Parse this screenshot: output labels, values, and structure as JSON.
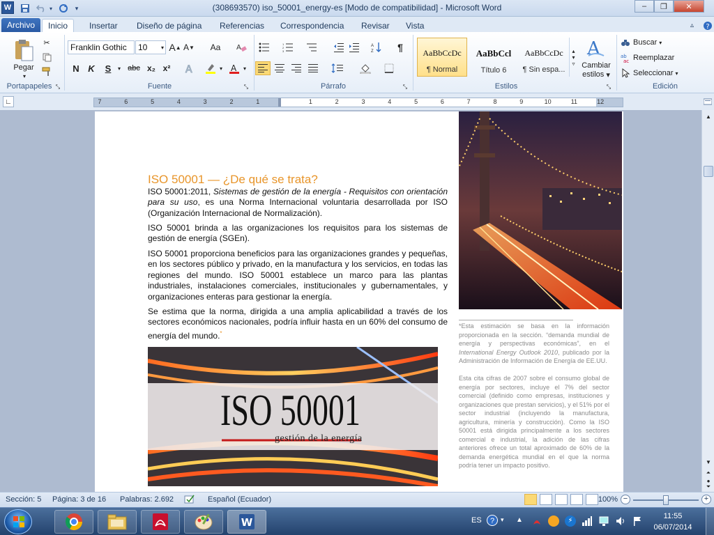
{
  "window": {
    "title": "(308693570) iso_50001_energy-es [Modo de compatibilidad]  -  Microsoft Word",
    "minimize": "–",
    "maximize": "❐",
    "close": "✕"
  },
  "qat": {
    "word_icon": "W",
    "save_icon": "save-icon",
    "undo_icon": "undo-icon",
    "redo_icon": "redo-icon"
  },
  "tabs": [
    "Archivo",
    "Inicio",
    "Insertar",
    "Diseño de página",
    "Referencias",
    "Correspondencia",
    "Revisar",
    "Vista"
  ],
  "ribbon": {
    "clipboard": {
      "paste_label": "Pegar",
      "group_label": "Portapapeles"
    },
    "font": {
      "font_name": "Franklin Gothic",
      "font_size": "10",
      "group_label": "Fuente",
      "bold": "N",
      "italic": "K",
      "underline": "S",
      "strike": "abc",
      "sub": "x₂",
      "sup": "x²",
      "grow": "A",
      "shrink": "A",
      "case": "Aa"
    },
    "paragraph": {
      "group_label": "Párrafo",
      "pilcrow": "¶"
    },
    "styles": {
      "group_label": "Estilos",
      "items": [
        {
          "preview": "AaBbCcDc",
          "label": "¶ Normal"
        },
        {
          "preview": "AaBbCcl",
          "label": "Título 6"
        },
        {
          "preview": "AaBbCcDc",
          "label": "¶ Sin espa..."
        }
      ],
      "change_label_1": "Cambiar",
      "change_label_2": "estilos"
    },
    "editing": {
      "group_label": "Edición",
      "find": "Buscar",
      "replace": "Reemplazar",
      "select": "Seleccionar"
    }
  },
  "ruler": {
    "ticks": [
      "7",
      "6",
      "5",
      "4",
      "3",
      "2",
      "1",
      "",
      "1",
      "2",
      "3",
      "4",
      "5",
      "6",
      "7",
      "8",
      "9",
      "10",
      "11",
      "12"
    ]
  },
  "document": {
    "heading": "ISO 50001 — ¿De qué se trata?",
    "p1_a": "ISO 50001:2011, ",
    "p1_b": "Sistemas de gestión de la energía - Requisitos con orientación para su uso",
    "p1_c": ", es una Norma Internacional voluntaria desarrollada por ISO (Organización Internacional de Normalización).",
    "p2": "ISO 50001 brinda a las organizaciones  los requisitos para los sistemas de gestión de energía (SGEn).",
    "p3": "ISO 50001 proporciona beneficios para las organizaciones grandes y pequeñas, en los sectores público y privado, en la manufactura y los servicios, en todas las regiones del mundo. ISO 50001 establece un marco para las plantas industriales, instalaciones comerciales, institucionales y gubernamentales,  y organizaciones enteras para gestionar la energía.",
    "p4": "Se estima que la norma, dirigida a una amplia aplicabilidad  a través de los sectores económicos  nacionales, podría influir hasta en un 60% del consumo de energía del mundo.",
    "p4_mark": "*",
    "banner_title": "ISO 50001",
    "banner_sub": "gestión de la energía",
    "note1_a": "*Esta estimación se basa en la ",
    "note1_b": "información",
    "note1_c": " proporcionada en la sección. “demanda mundial de energía y perspectivas económicas”, en el ",
    "note1_d": "International Energy Outlook 2010",
    "note1_e": ", publicado por la Administración de ",
    "note1_f": "Información",
    "note1_g": " de Energía de EE.UU.",
    "note2": "Esta cita cifras de 2007 sobre el consumo global de energía por sectores, incluye el 7% del sector comercial (definido como empresas, instituciones y organizaciones que prestan servicios), y el 51% por el sector industrial (incluyendo la manufactura, agricultura, minería y construcción). Como la ISO 50001 está dirigida principalmente a los sectores comercial e industrial, la adición de las cifras anteriores ofrece un total aproximado de 60% de la demanda energética mundial en el que la norma podría tener un impacto positivo."
  },
  "status": {
    "section": "Sección: 5",
    "page": "Página: 3 de 16",
    "words": "Palabras: 2.692",
    "language": "Español (Ecuador)",
    "zoom": "100%",
    "zoom_value": 100
  },
  "taskbar": {
    "lang": "ES",
    "time": "11:55",
    "date": "06/07/2014",
    "apps": [
      "chrome-icon",
      "folder-icon",
      "pdf-icon",
      "paint-icon",
      "word-icon"
    ]
  },
  "colors": {
    "accent": "#e8952a",
    "ribbon_blue": "#2b579a",
    "banner_red": "#c41a1a"
  }
}
